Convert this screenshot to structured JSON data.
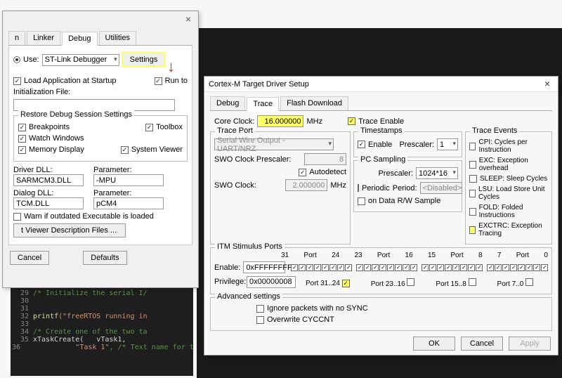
{
  "dlg1": {
    "tabs": [
      "n",
      "Linker",
      "Debug",
      "Utilities"
    ],
    "active_tab": 2,
    "use_label": "Use:",
    "debugger": "ST-Link Debugger",
    "settings_btn": "Settings",
    "load_app": "Load Application at Startup",
    "run_to": "Run to",
    "init_file": "Initialization File:",
    "init_val": "",
    "restore_legend": "Restore Debug Session Settings",
    "breakpoints": "Breakpoints",
    "toolbox": "Toolbox",
    "watch": "Watch Windows",
    "memory": "Memory Display",
    "sysviewer": "System Viewer",
    "driver_dll": "Driver DLL:",
    "driver_val": "SARMCM3.DLL",
    "param1": "Parameter:",
    "param1_val": "-MPU",
    "dialog_dll": "Dialog DLL:",
    "dialog_val": "TCM.DLL",
    "param2": "Parameter:",
    "param2_val": "pCM4",
    "warn_exec": "Warn if outdated Executable is loaded",
    "viewer_files": "t Viewer Description Files ...",
    "cancel": "Cancel",
    "defaults": "Defaults"
  },
  "dlg2": {
    "title": "Cortex-M Target Driver Setup",
    "tabs": [
      "Debug",
      "Trace",
      "Flash Download"
    ],
    "active_tab": 1,
    "core_clock_label": "Core Clock:",
    "core_clock": "16.000000",
    "mhz": "MHz",
    "trace_enable": "Trace Enable",
    "trace_port_legend": "Trace Port",
    "trace_port_val": "Serial Wire Output - UART/NRZ",
    "swo_presc_label": "SWO Clock Prescaler:",
    "swo_presc": "8",
    "autodetect": "Autodetect",
    "swo_clock_label": "SWO Clock:",
    "swo_clock": "2.000000",
    "timestamps_legend": "Timestamps",
    "ts_enable": "Enable",
    "ts_presc_label": "Prescaler:",
    "ts_presc": "1",
    "pc_legend": "PC Sampling",
    "pc_presc_label": "Prescaler:",
    "pc_presc": "1024*16",
    "periodic": "Periodic",
    "period_label": "Period:",
    "period_val": "<Disabled>",
    "on_rw": "on Data R/W Sample",
    "te_legend": "Trace Events",
    "te_cpi": "CPI: Cycles per Instruction",
    "te_exc": "EXC: Exception overhead",
    "te_sleep": "SLEEP: Sleep Cycles",
    "te_lsu": "LSU: Load Store Unit Cycles",
    "te_fold": "FOLD: Folded Instructions",
    "te_exctrc": "EXCTRC: Exception Tracing",
    "stim_legend": "ITM Stimulus Ports",
    "enable_label": "Enable:",
    "enable_val": "0xFFFFFFFF",
    "priv_label": "Privilege:",
    "priv_val": "0x00000008",
    "port_hdrs": [
      "31",
      "Port",
      "24",
      "23",
      "Port",
      "16",
      "15",
      "Port",
      "8",
      "7",
      "Port",
      "0"
    ],
    "pg3124": "Port 31..24",
    "pg2316": "Port 23..16",
    "pg158": "Port 15..8",
    "pg70": "Port 7..0",
    "adv_legend": "Advanced settings",
    "adv_ignore": "Ignore packets with no SYNC",
    "adv_cyccnt": "Overwrite CYCCNT",
    "ok": "OK",
    "cancel": "Cancel",
    "apply": "Apply"
  },
  "code": {
    "l29c": "/* Initialize the serial I/",
    "l32a": "printf",
    "l32b": "(\"freeRTOS running in",
    "l34c": "/* Create one of the two ta",
    "l35a": "xTaskCreate(   vTask1,",
    "l36a": "\"Task 1\"",
    "l36b": ", /* Text name for the task.  This is to facilitate debugging only. */"
  }
}
